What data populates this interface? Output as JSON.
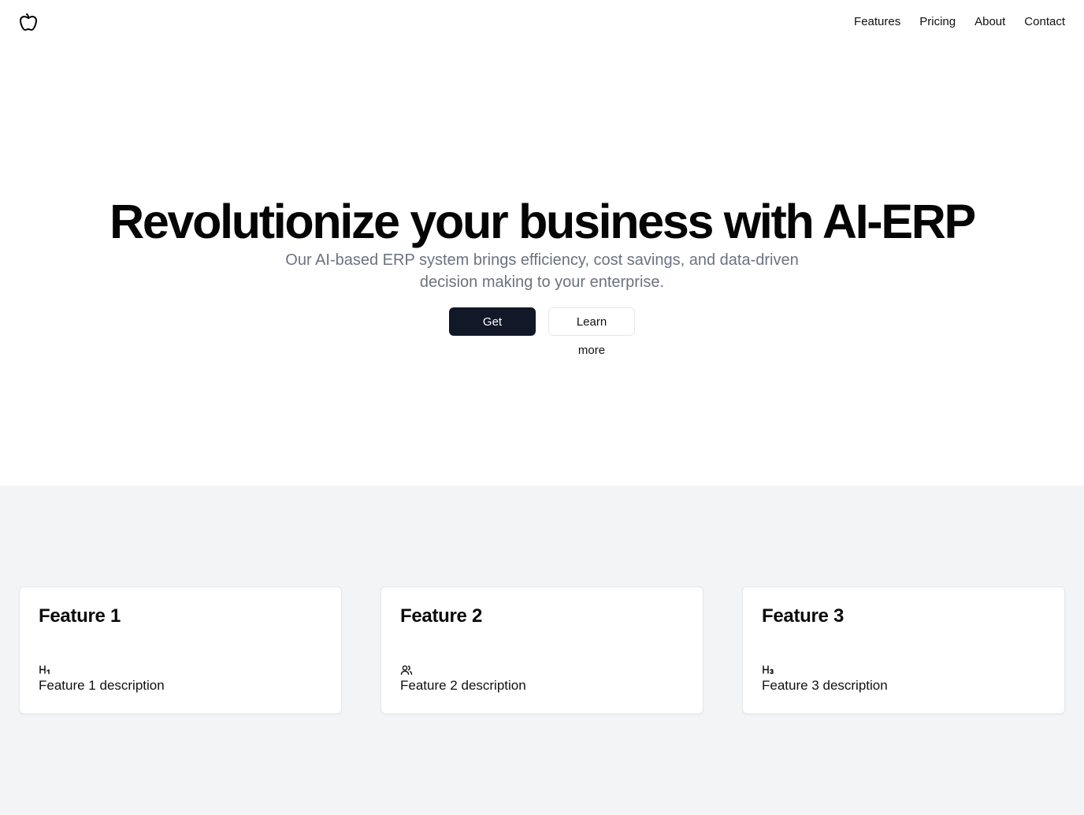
{
  "header": {
    "logo_icon": "apple-icon",
    "nav": [
      {
        "label": "Features"
      },
      {
        "label": "Pricing"
      },
      {
        "label": "About"
      },
      {
        "label": "Contact"
      }
    ]
  },
  "hero": {
    "title": "Revolutionize your business with AI-ERP",
    "subtitle": "Our AI-based ERP system brings efficiency, cost savings, and data-driven decision making to your enterprise.",
    "primary_cta": "Get Started",
    "secondary_cta": "Learn more"
  },
  "features": {
    "cards": [
      {
        "title": "Feature 1",
        "icon": "heading-1-icon",
        "description": "Feature 1 description"
      },
      {
        "title": "Feature 2",
        "icon": "users-icon",
        "description": "Feature 2 description"
      },
      {
        "title": "Feature 3",
        "icon": "heading-3-icon",
        "description": "Feature 3 description"
      }
    ]
  },
  "colors": {
    "primary_button": "#111827",
    "subtitle_text": "#6b7280",
    "features_background": "#f2f4f6"
  }
}
